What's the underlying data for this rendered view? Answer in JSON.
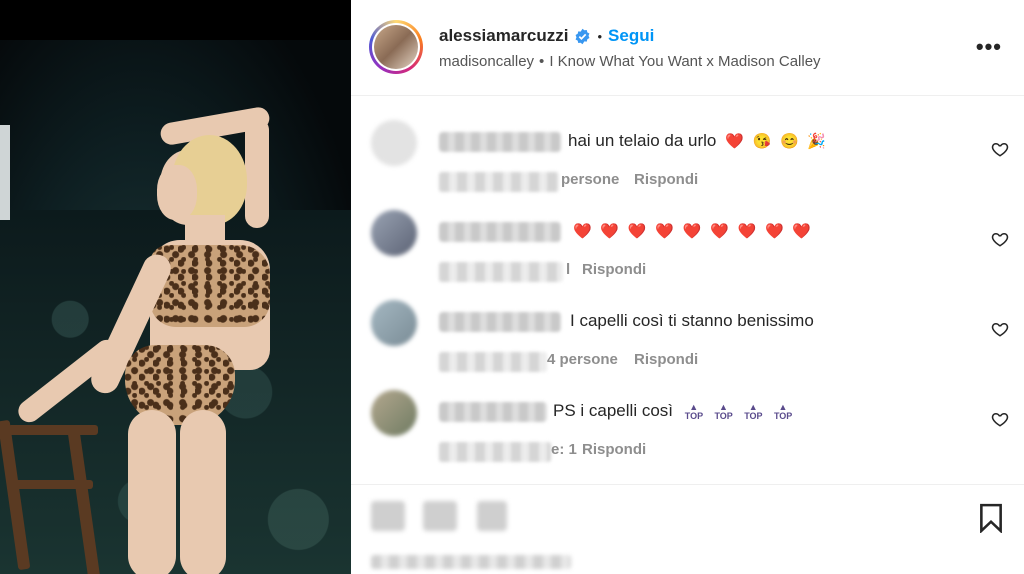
{
  "post": {
    "username": "alessiamarcuzzi",
    "follow_label": "Segui",
    "separator": "•",
    "audio_owner": "madisoncalley",
    "audio_title": "I Know What You Want x Madison Calley",
    "more_label": "•••"
  },
  "comments": [
    {
      "text": "hai un telaio da urlo",
      "emojis": [
        "❤️",
        "😘",
        "😊",
        "🎉"
      ],
      "meta_tail": "persone",
      "reply_label": "Rispondi"
    },
    {
      "text": "",
      "emojis": [
        "❤️",
        "❤️",
        "❤️",
        "❤️",
        "❤️",
        "❤️",
        "❤️",
        "❤️",
        "❤️"
      ],
      "meta_tail": "l",
      "reply_label": "Rispondi"
    },
    {
      "text": "I capelli così ti stanno benissimo",
      "emojis": [],
      "meta_tail": "4 persone",
      "reply_label": "Rispondi"
    },
    {
      "text": "PS i capelli così",
      "emojis": [
        "TOP",
        "TOP",
        "TOP",
        "TOP"
      ],
      "meta_tail": "e: 1",
      "reply_label": "Rispondi"
    }
  ],
  "colors": {
    "accent": "#0095f6",
    "verified": "#3897f0",
    "heart_emoji": "#e0245e"
  },
  "icons": {
    "verified": "verified-badge-icon",
    "heart": "heart-outline-icon",
    "bookmark": "bookmark-icon",
    "more": "more-horizontal-icon"
  }
}
